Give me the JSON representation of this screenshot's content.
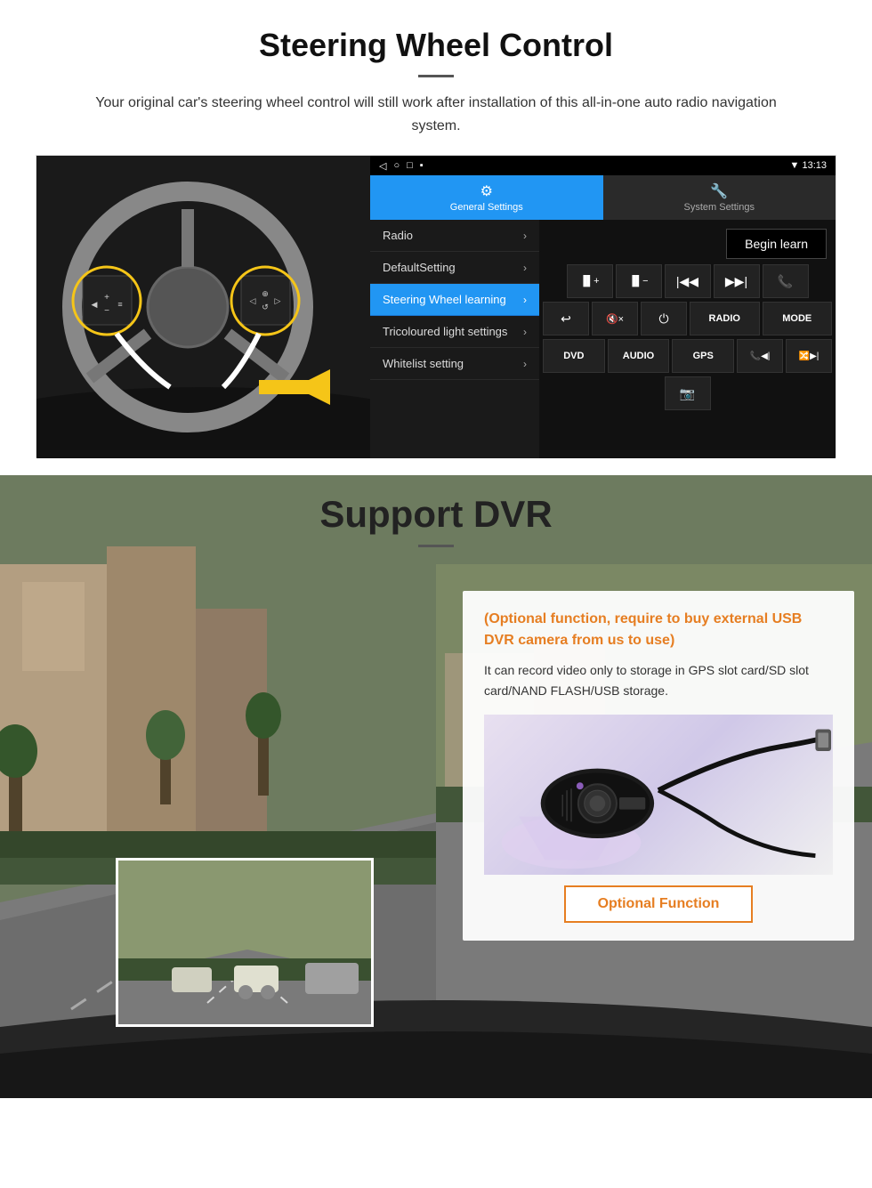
{
  "section1": {
    "title": "Steering Wheel Control",
    "subtitle": "Your original car's steering wheel control will still work after installation of this all-in-one auto radio navigation system.",
    "android": {
      "statusBar": {
        "icons": [
          "◁",
          "○",
          "□",
          "▪"
        ],
        "time": "13:13",
        "signal": "▼"
      },
      "tabs": [
        {
          "label": "General Settings",
          "active": true
        },
        {
          "label": "System Settings",
          "active": false
        }
      ],
      "menuItems": [
        {
          "label": "Radio",
          "active": false
        },
        {
          "label": "DefaultSetting",
          "active": false
        },
        {
          "label": "Steering Wheel learning",
          "active": true
        },
        {
          "label": "Tricoloured light settings",
          "active": false
        },
        {
          "label": "Whitelist setting",
          "active": false
        }
      ],
      "beginLearnLabel": "Begin learn",
      "controlButtons": {
        "row1": [
          "◀◀+",
          "◀◀−",
          "◀◀",
          "▶▶|",
          "☎"
        ],
        "row2": [
          "↩",
          "🔇×",
          "⏻",
          "RADIO",
          "MODE"
        ],
        "row3": [
          "DVD",
          "AUDIO",
          "GPS",
          "📞◀|",
          "🔀▶|"
        ],
        "row4": [
          "📷"
        ]
      }
    }
  },
  "section2": {
    "title": "Support DVR",
    "card": {
      "optionalText": "(Optional function, require to buy external USB DVR camera from us to use)",
      "description": "It can record video only to storage in GPS slot card/SD slot card/NAND FLASH/USB storage.",
      "buttonLabel": "Optional Function"
    }
  }
}
